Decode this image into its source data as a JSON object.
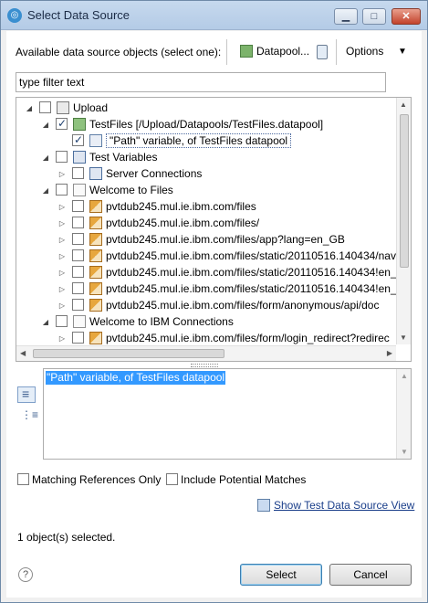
{
  "window": {
    "title": "Select Data Source",
    "controls": {
      "minimize": "▁",
      "maximize": "□",
      "close": "✕"
    }
  },
  "toolbar": {
    "label": "Available data source objects (select one):",
    "datapool_label": "Datapool...",
    "options_label": "Options",
    "options_arrow": "▼"
  },
  "filter": {
    "value": "type filter text"
  },
  "tree": {
    "items": [
      {
        "twisty": "◢",
        "checked": false,
        "icon": "folder",
        "label": "Upload"
      },
      {
        "twisty": "◢",
        "checked": true,
        "icon": "datapool",
        "label": "TestFiles [/Upload/Datapools/TestFiles.datapool]"
      },
      {
        "twisty": "",
        "checked": true,
        "icon": "variable",
        "label": "\"Path\" variable, of TestFiles datapool",
        "selected": true
      },
      {
        "twisty": "◢",
        "checked": false,
        "icon": "test-variables",
        "label": "Test Variables"
      },
      {
        "twisty": "▷",
        "checked": false,
        "icon": "test-variables",
        "label": "Server Connections"
      },
      {
        "twisty": "◢",
        "checked": false,
        "icon": "page",
        "label": "Welcome to Files"
      },
      {
        "twisty": "▷",
        "checked": false,
        "icon": "request",
        "label": "pvtdub245.mul.ie.ibm.com/files"
      },
      {
        "twisty": "▷",
        "checked": false,
        "icon": "request",
        "label": "pvtdub245.mul.ie.ibm.com/files/"
      },
      {
        "twisty": "▷",
        "checked": false,
        "icon": "request",
        "label": "pvtdub245.mul.ie.ibm.com/files/app?lang=en_GB"
      },
      {
        "twisty": "▷",
        "checked": false,
        "icon": "request",
        "label": "pvtdub245.mul.ie.ibm.com/files/static/20110516.140434/nav"
      },
      {
        "twisty": "▷",
        "checked": false,
        "icon": "request",
        "label": "pvtdub245.mul.ie.ibm.com/files/static/20110516.140434!en_"
      },
      {
        "twisty": "▷",
        "checked": false,
        "icon": "request",
        "label": "pvtdub245.mul.ie.ibm.com/files/static/20110516.140434!en_"
      },
      {
        "twisty": "▷",
        "checked": false,
        "icon": "request",
        "label": "pvtdub245.mul.ie.ibm.com/files/form/anonymous/api/doc"
      },
      {
        "twisty": "◢",
        "checked": false,
        "icon": "page",
        "label": "Welcome to IBM Connections"
      },
      {
        "twisty": "▷",
        "checked": false,
        "icon": "request",
        "label": "pvtdub245.mul.ie.ibm.com/files/form/login_redirect?redirec"
      }
    ]
  },
  "detail": {
    "text": "\"Path\" variable, of TestFiles datapool"
  },
  "options": {
    "matching_references_only": "Matching References Only",
    "include_potential_matches": "Include Potential Matches"
  },
  "link": {
    "show_view": "Show Test Data Source View"
  },
  "status": {
    "text": "1 object(s) selected."
  },
  "buttons": {
    "select": "Select",
    "cancel": "Cancel",
    "help": "?"
  }
}
